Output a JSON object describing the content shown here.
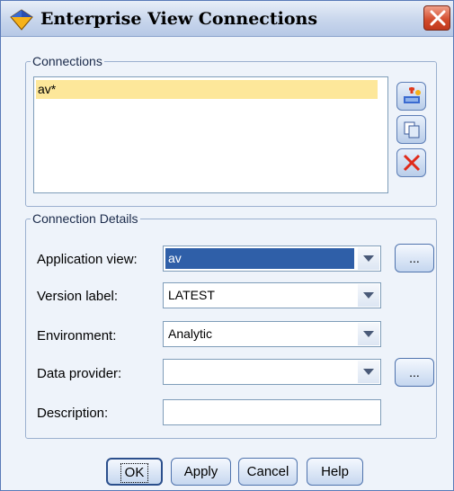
{
  "window": {
    "title": "Enterprise View Connections"
  },
  "connections": {
    "legend": "Connections",
    "items": [
      {
        "label": "av*",
        "selected": true
      }
    ],
    "side_buttons": [
      "add-connection-icon",
      "copy-icon",
      "delete-icon"
    ]
  },
  "details": {
    "legend": "Connection Details",
    "application_view": {
      "label": "Application view:",
      "value": "av"
    },
    "version_label": {
      "label": "Version label:",
      "value": "LATEST"
    },
    "environment": {
      "label": "Environment:",
      "value": "Analytic"
    },
    "data_provider": {
      "label": "Data provider:",
      "value": ""
    },
    "description": {
      "label": "Description:",
      "value": ""
    },
    "browse_label": "..."
  },
  "buttons": {
    "ok": "OK",
    "apply": "Apply",
    "cancel": "Cancel",
    "help": "Help"
  },
  "colors": {
    "selection": "#fde79a",
    "combo_selected": "#2f5fa8",
    "close": "#d24a2a",
    "delete": "#e02a1a"
  }
}
